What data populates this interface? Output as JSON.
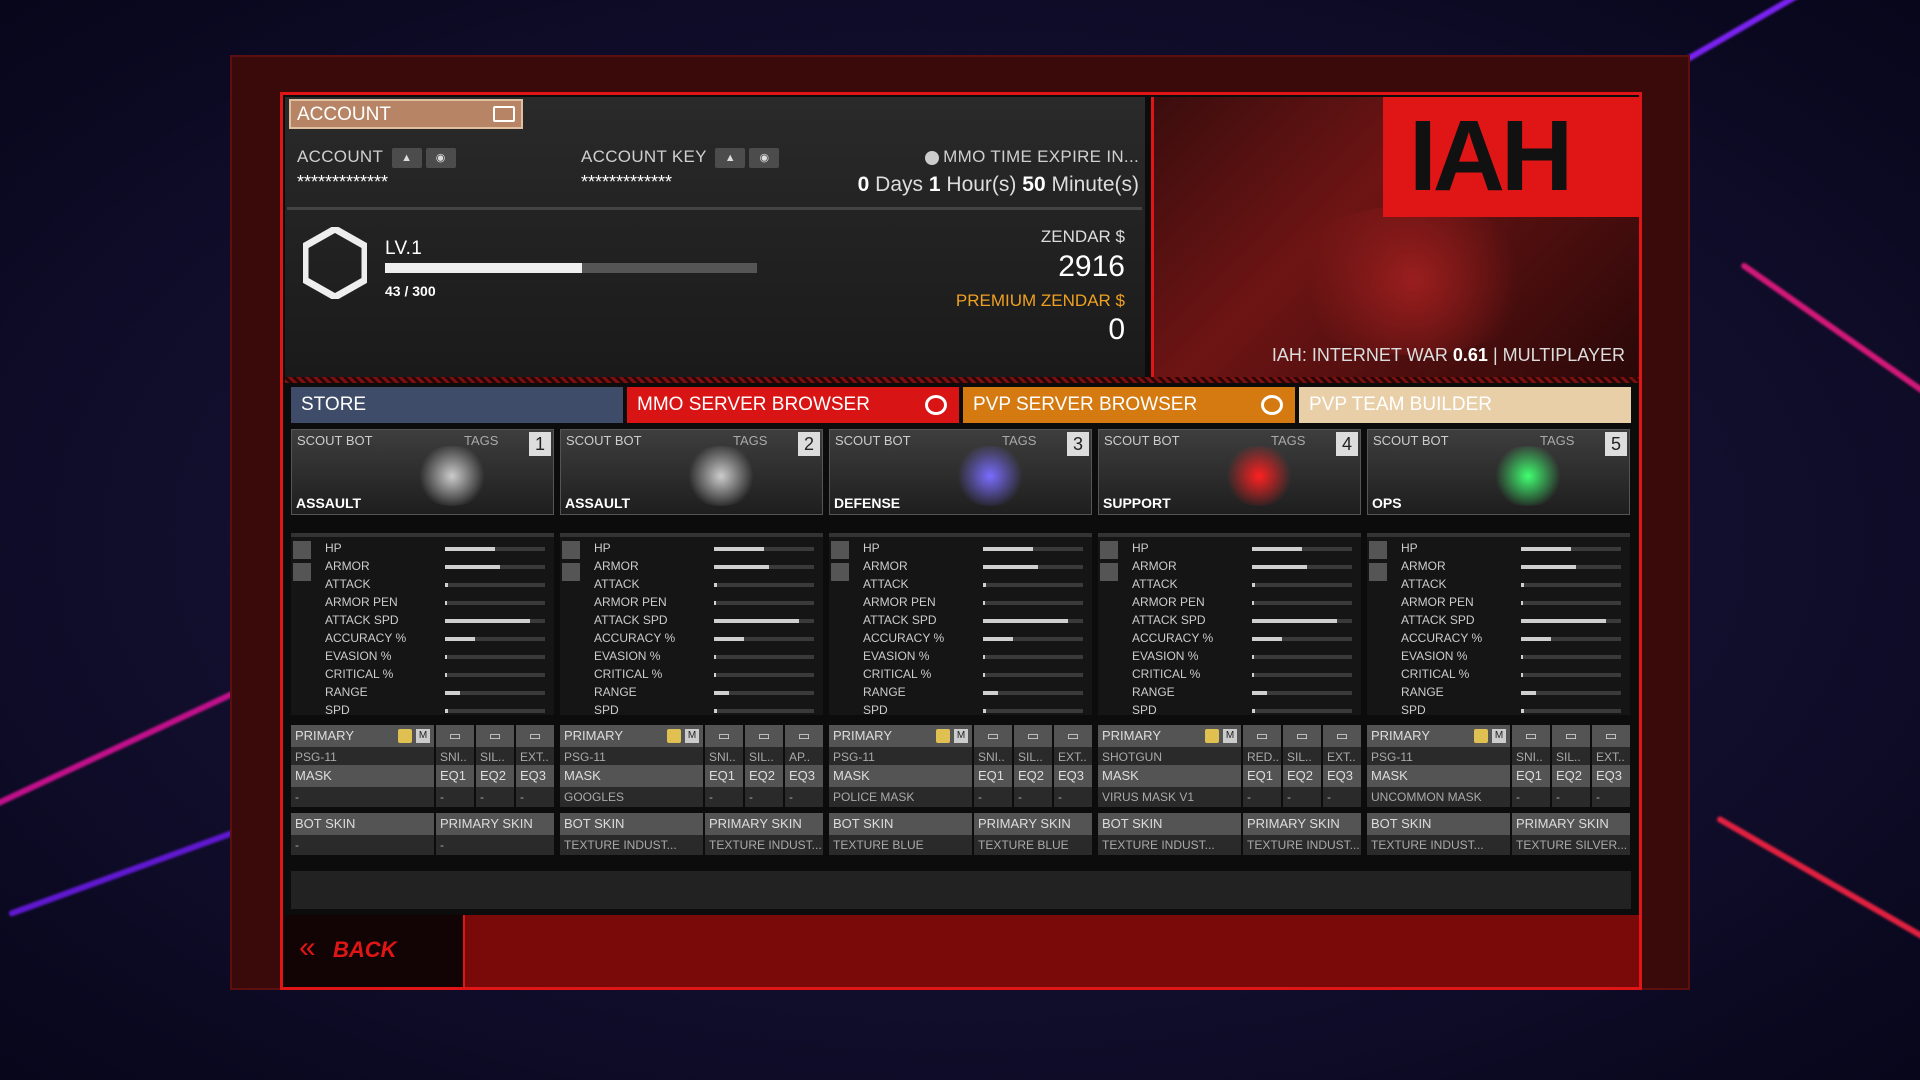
{
  "account": {
    "header_label": "ACCOUNT",
    "account_label": "ACCOUNT",
    "account_value": "*************",
    "key_label": "ACCOUNT KEY",
    "key_value": "*************",
    "expire_label": "MMO TIME EXPIRE IN...",
    "days": "0",
    "days_unit": "Days",
    "hours": "1",
    "hours_unit": "Hour(s)",
    "minutes": "50",
    "minutes_unit": "Minute(s)"
  },
  "level": {
    "label": "LV.1",
    "xp_text": "43 / 300",
    "fill_percent": 53
  },
  "currency": {
    "zendar_label": "ZENDAR $",
    "zendar_value": "2916",
    "premium_label": "PREMIUM ZENDAR $",
    "premium_value": "0"
  },
  "banner": {
    "logo": "IAH",
    "version_prefix": "IAH: INTERNET WAR ",
    "version": "0.61",
    "version_suffix": " | MULTIPLAYER"
  },
  "tabs": [
    "STORE",
    "MMO SERVER BROWSER",
    "PVP SERVER BROWSER",
    "PVP TEAM BUILDER"
  ],
  "stat_names": [
    "HP",
    "ARMOR",
    "ATTACK",
    "ARMOR PEN",
    "ATTACK SPD",
    "ACCURACY %",
    "EVASION %",
    "CRITICAL %",
    "RANGE",
    "SPD"
  ],
  "labels": {
    "primary": "PRIMARY",
    "mask": "MASK",
    "bot_skin": "BOT SKIN",
    "primary_skin": "PRIMARY SKIN",
    "eq1": "EQ1",
    "eq2": "EQ2",
    "eq3": "EQ3",
    "m": "M",
    "tags": "TAGS"
  },
  "slots": [
    {
      "title": "SCOUT BOT",
      "num": "1",
      "role": "ASSAULT",
      "glow": "#cccccc",
      "weapon": "PSG-11",
      "att": [
        "SNI..",
        "SIL..",
        "EXT.."
      ],
      "mask": "-",
      "eq": [
        "-",
        "-",
        "-"
      ],
      "bot_skin": "-",
      "primary_skin": "-",
      "stats": [
        0.5,
        0.55,
        0.03,
        0.02,
        0.85,
        0.3,
        0.02,
        0.02,
        0.15,
        0.03
      ]
    },
    {
      "title": "SCOUT BOT",
      "num": "2",
      "role": "ASSAULT",
      "glow": "#cccccc",
      "weapon": "PSG-11",
      "att": [
        "SNI..",
        "SIL..",
        "AP.."
      ],
      "mask": "GOOGLES",
      "eq": [
        "-",
        "-",
        "-"
      ],
      "bot_skin": "TEXTURE INDUST...",
      "primary_skin": "TEXTURE INDUST...",
      "stats": [
        0.5,
        0.55,
        0.03,
        0.02,
        0.85,
        0.3,
        0.02,
        0.02,
        0.15,
        0.03
      ]
    },
    {
      "title": "SCOUT BOT",
      "num": "3",
      "role": "DEFENSE",
      "glow": "#7a6cff",
      "weapon": "PSG-11",
      "att": [
        "SNI..",
        "SIL..",
        "EXT.."
      ],
      "mask": "POLICE MASK",
      "eq": [
        "-",
        "-",
        "-"
      ],
      "bot_skin": "TEXTURE BLUE",
      "primary_skin": "TEXTURE BLUE",
      "stats": [
        0.5,
        0.55,
        0.03,
        0.02,
        0.85,
        0.3,
        0.02,
        0.02,
        0.15,
        0.03
      ]
    },
    {
      "title": "SCOUT BOT",
      "num": "4",
      "role": "SUPPORT",
      "glow": "#ff2020",
      "weapon": "SHOTGUN",
      "att": [
        "RED..",
        "SIL..",
        "EXT.."
      ],
      "mask": "VIRUS MASK V1",
      "eq": [
        "-",
        "-",
        "-"
      ],
      "bot_skin": "TEXTURE INDUST...",
      "primary_skin": "TEXTURE INDUST...",
      "stats": [
        0.5,
        0.55,
        0.03,
        0.02,
        0.85,
        0.3,
        0.02,
        0.02,
        0.15,
        0.03
      ]
    },
    {
      "title": "SCOUT BOT",
      "num": "5",
      "role": "OPS",
      "glow": "#40ff70",
      "weapon": "PSG-11",
      "att": [
        "SNI..",
        "SIL..",
        "EXT.."
      ],
      "mask": "UNCOMMON MASK",
      "eq": [
        "-",
        "-",
        "-"
      ],
      "bot_skin": "TEXTURE INDUST...",
      "primary_skin": "TEXTURE SILVER...",
      "stats": [
        0.5,
        0.55,
        0.03,
        0.02,
        0.85,
        0.3,
        0.02,
        0.02,
        0.15,
        0.03
      ]
    }
  ],
  "back_label": "BACK",
  "colors": {
    "accent_red": "#e01515",
    "store_tab": "#3e4c6a",
    "mmo_tab": "#d81414",
    "pvp_tab": "#d57a10",
    "team_tab": "#e8cfa8",
    "premium": "#f0a020"
  }
}
